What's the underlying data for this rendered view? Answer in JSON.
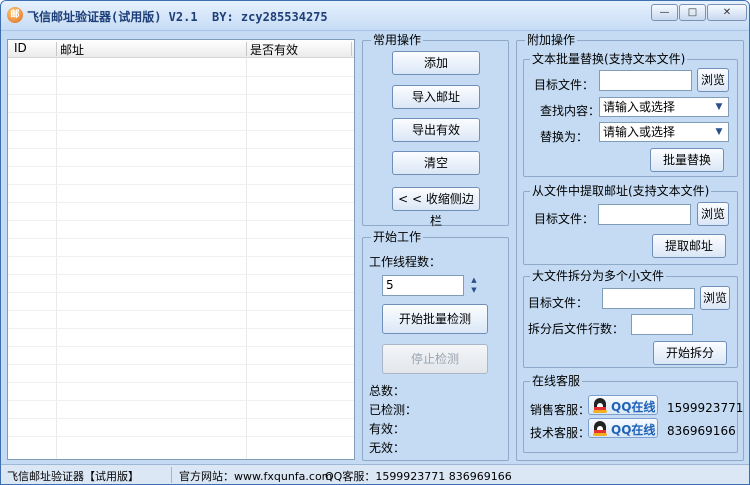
{
  "window": {
    "title": "飞信邮址验证器(试用版) V2.1  BY: zcy285534275",
    "app_icon_glyph": "邮",
    "controls": {
      "minimize": "—",
      "maximize": "□",
      "close": "✕"
    }
  },
  "list": {
    "columns": [
      "ID",
      "邮址",
      "是否有效"
    ],
    "rows": []
  },
  "common_ops": {
    "title": "常用操作",
    "buttons": {
      "add": "添加",
      "import": "导入邮址",
      "export": "导出有效",
      "clear": "清空",
      "collapse": "< < 收缩侧边栏"
    }
  },
  "start_work": {
    "title": "开始工作",
    "threads_label": "工作线程数：",
    "threads_value": "5",
    "start_button": "开始批量检测",
    "stop_button": "停止检测",
    "total_label": "总数：",
    "checked_label": "已检测：",
    "valid_label": "有效：",
    "invalid_label": "无效："
  },
  "extra_ops": {
    "title": "附加操作",
    "replace": {
      "title": "文本批量替换(支持文本文件)",
      "target_label": "目标文件：",
      "target_value": "",
      "browse": "浏览",
      "find_label": "查找内容：",
      "find_placeholder": "请输入或选择",
      "replace_label": "替换为：",
      "replace_placeholder": "请输入或选择",
      "action": "批量替换"
    },
    "extract": {
      "title": "从文件中提取邮址(支持文本文件)",
      "target_label": "目标文件：",
      "target_value": "",
      "browse": "浏览",
      "action": "提取邮址"
    },
    "split": {
      "title": "大文件拆分为多个小文件",
      "target_label": "目标文件：",
      "target_value": "",
      "browse": "浏览",
      "lines_label": "拆分后文件行数：",
      "lines_value": "",
      "action": "开始拆分"
    },
    "support": {
      "title": "在线客服",
      "sales_label": "销售客服：",
      "sales_qq": "1599923771",
      "tech_label": "技术客服：",
      "tech_qq": "836969166",
      "qq_button": "QQ在线"
    }
  },
  "statusbar": {
    "app": "飞信邮址验证器【试用版】",
    "website": "官方网站：www.fxqunfa.com",
    "qq": "QQ客服：1599923771  836969166"
  }
}
